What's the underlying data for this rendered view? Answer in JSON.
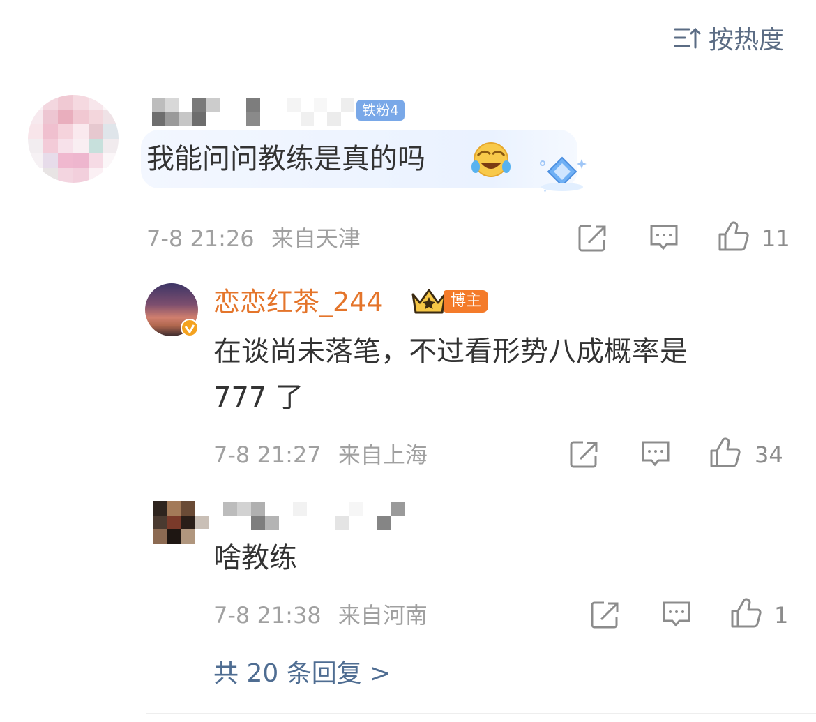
{
  "header": {
    "sort_label": "按热度",
    "sort_icon": "sort-desc-icon"
  },
  "comment": {
    "fan_badge": "铁粉4",
    "text": "我能问问教练是真的吗",
    "emoji": "laugh-cry-emoji",
    "time": "7-8 21:26",
    "location": "来自天津",
    "likes": "11"
  },
  "replies": [
    {
      "name": "恋恋红茶_244",
      "tag": "博主",
      "text_line1": "在谈尚未落笔，不过看形势八成概率是",
      "text_line2": "777 了",
      "time": "7-8 21:27",
      "location": "来自上海",
      "likes": "34"
    },
    {
      "text": "啥教练",
      "time": "7-8 21:38",
      "location": "来自河南",
      "likes": "1"
    }
  ],
  "more_replies": "共 20 条回复 >",
  "colors": {
    "link": "#5b6c84",
    "blogger": "#e4752b",
    "badge": "#79a8e8",
    "tag": "#f47b2a"
  }
}
